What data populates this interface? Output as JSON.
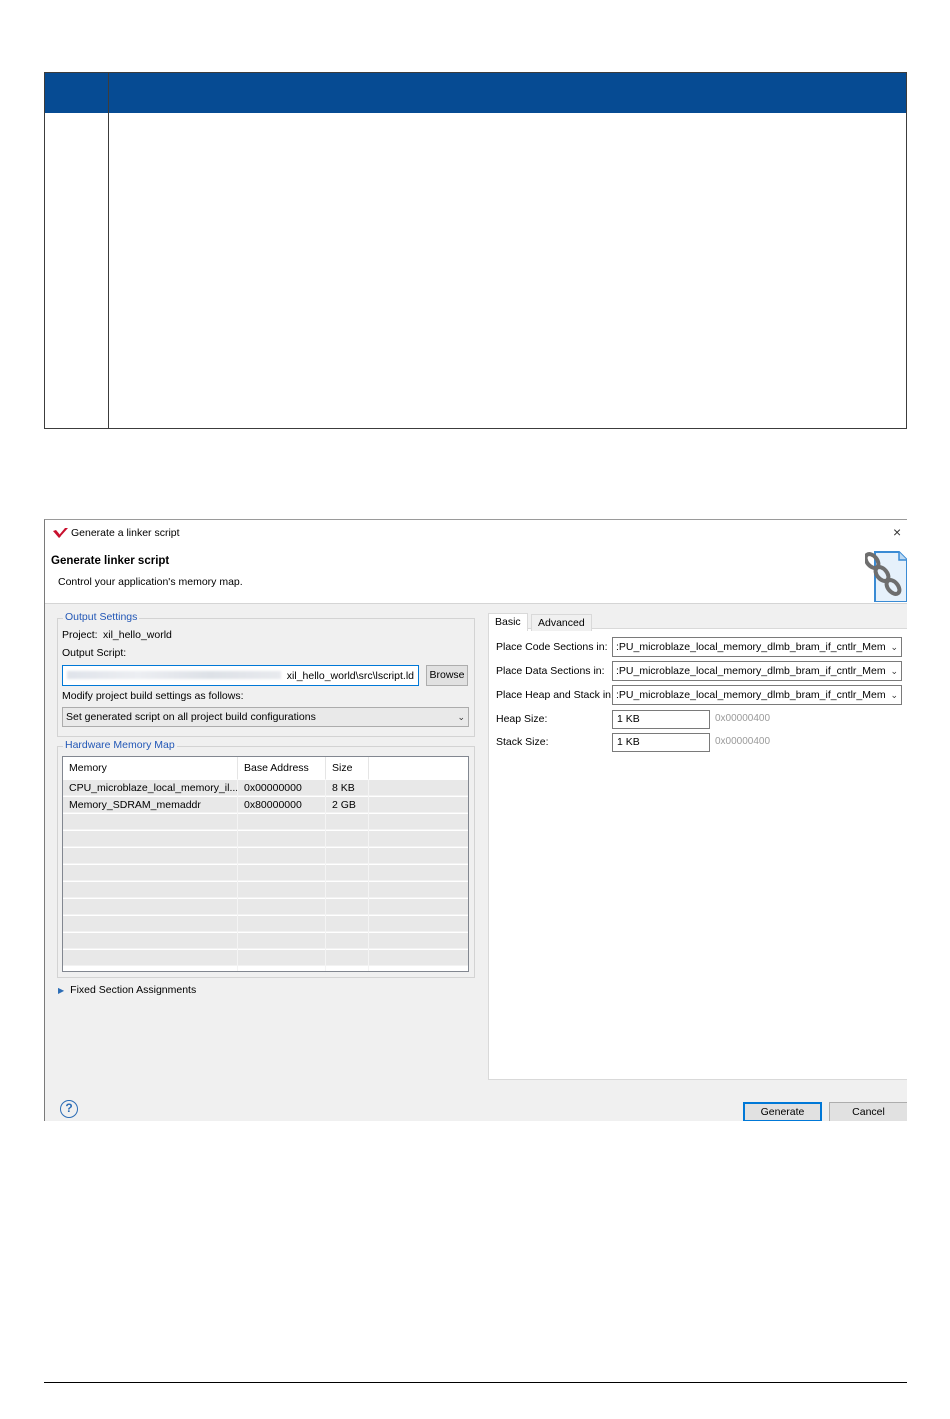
{
  "dialog": {
    "window_title": "Generate a linker script",
    "banner_title": "Generate linker script",
    "banner_description": "Control your application's memory map.",
    "output_settings": {
      "group_title": "Output Settings",
      "project_label": "Project:",
      "project_value": "xil_hello_world",
      "output_script_label": "Output Script:",
      "output_script_value": "xil_hello_world\\src\\lscript.ld",
      "browse_label": "Browse",
      "modify_label": "Modify project build settings as follows:",
      "build_config_selected": "Set generated script on all project build configurations"
    },
    "hardware_memory_map": {
      "group_title": "Hardware Memory Map",
      "columns": [
        "Memory",
        "Base Address",
        "Size"
      ],
      "rows": [
        [
          "CPU_microblaze_local_memory_il...",
          "0x00000000",
          "8 KB"
        ],
        [
          "Memory_SDRAM_memaddr",
          "0x80000000",
          "2 GB"
        ]
      ]
    },
    "fixed_section_assignments": "Fixed Section Assignments",
    "tabs": [
      "Basic",
      "Advanced"
    ],
    "basic": {
      "place_code_label": "Place Code Sections in:",
      "place_code_value": ":PU_microblaze_local_memory_dlmb_bram_if_cntlr_Mem",
      "place_data_label": "Place Data Sections in:",
      "place_data_value": ":PU_microblaze_local_memory_dlmb_bram_if_cntlr_Mem",
      "place_heap_label": "Place Heap and Stack in:",
      "place_heap_value": ":PU_microblaze_local_memory_dlmb_bram_if_cntlr_Mem",
      "heap_size_label": "Heap Size:",
      "heap_size_value": "1 KB",
      "heap_size_hex": "0x00000400",
      "stack_size_label": "Stack Size:",
      "stack_size_value": "1 KB",
      "stack_size_hex": "0x00000400"
    },
    "buttons": {
      "generate": "Generate",
      "cancel": "Cancel",
      "help": "?",
      "close": "×"
    }
  },
  "colors": {
    "table_header_blue": "#064b93",
    "group_title_blue": "#2257b6",
    "focus_blue": "#0078d7",
    "brand_red": "#c8102e"
  },
  "icons": [
    "xilinx-logo-icon",
    "close-icon",
    "linker-chain-icon",
    "dropdown-arrow-icon",
    "expand-triangle-icon",
    "help-icon"
  ]
}
